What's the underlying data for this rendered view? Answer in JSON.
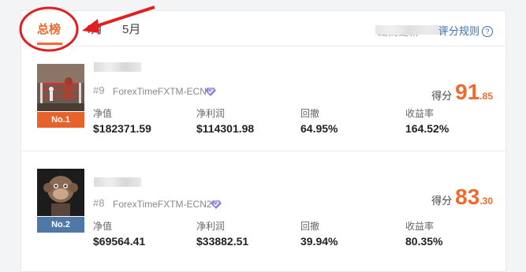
{
  "tabs": [
    {
      "label": "总榜",
      "active": true
    },
    {
      "label": "4月",
      "active": false
    },
    {
      "label": "5月",
      "active": false
    }
  ],
  "update_text": "距离更新",
  "rules_link": {
    "label": "评分规则",
    "icon": "help-circle-icon"
  },
  "score_label": "得分",
  "stat_labels": [
    "净值",
    "净利润",
    "回撤",
    "收益率"
  ],
  "entries": [
    {
      "rank_badge": "No.1",
      "rank_num": "#9",
      "account": "ForexTimeFXTM-ECN",
      "score_int": "91",
      "score_dec": ".85",
      "stats": [
        "$182371.59",
        "$114301.98",
        "64.95%",
        "164.52%"
      ]
    },
    {
      "rank_badge": "No.2",
      "rank_num": "#8",
      "account": "ForexTimeFXTM-ECN2",
      "score_int": "83",
      "score_dec": ".30",
      "stats": [
        "$69564.41",
        "$33882.51",
        "39.94%",
        "80.35%"
      ]
    }
  ],
  "colors": {
    "accent": "#ef6a2c",
    "link": "#3a6fb0",
    "badge_gold": "#e8632c",
    "badge_silver": "#4f78a7",
    "annotation_red": "#e02020"
  }
}
